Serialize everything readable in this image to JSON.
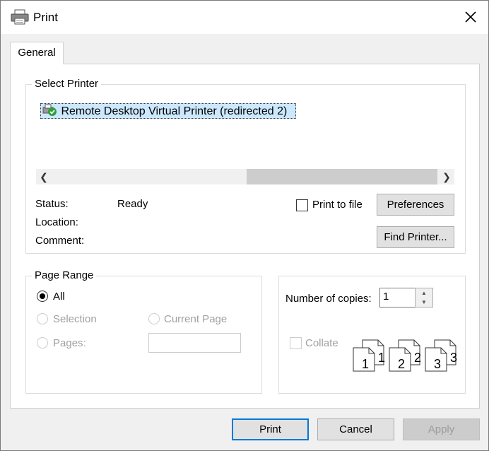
{
  "window": {
    "title": "Print"
  },
  "tabs": [
    {
      "label": "General"
    }
  ],
  "select_printer": {
    "title": "Select Printer",
    "printers": [
      {
        "name": "Remote Desktop Virtual Printer (redirected 2)",
        "selected": true
      }
    ],
    "status_label": "Status:",
    "status_value": "Ready",
    "location_label": "Location:",
    "comment_label": "Comment:",
    "print_to_file_label": "Print to file",
    "print_to_file_checked": false,
    "preferences_label": "Preferences",
    "find_printer_label": "Find Printer..."
  },
  "page_range": {
    "title": "Page Range",
    "all_label": "All",
    "selection_label": "Selection",
    "current_page_label": "Current Page",
    "pages_label": "Pages:",
    "pages_value": "",
    "selected": "All"
  },
  "copies": {
    "label": "Number of copies:",
    "value": "1",
    "collate_label": "Collate",
    "collate_checked": false,
    "collate_pages": [
      "1",
      "1",
      "2",
      "2",
      "3",
      "3"
    ]
  },
  "buttons": {
    "print": "Print",
    "cancel": "Cancel",
    "apply": "Apply"
  },
  "colors": {
    "accent": "#0078d7",
    "selection": "#cce8ff",
    "window_bg": "#f0f0f0"
  }
}
